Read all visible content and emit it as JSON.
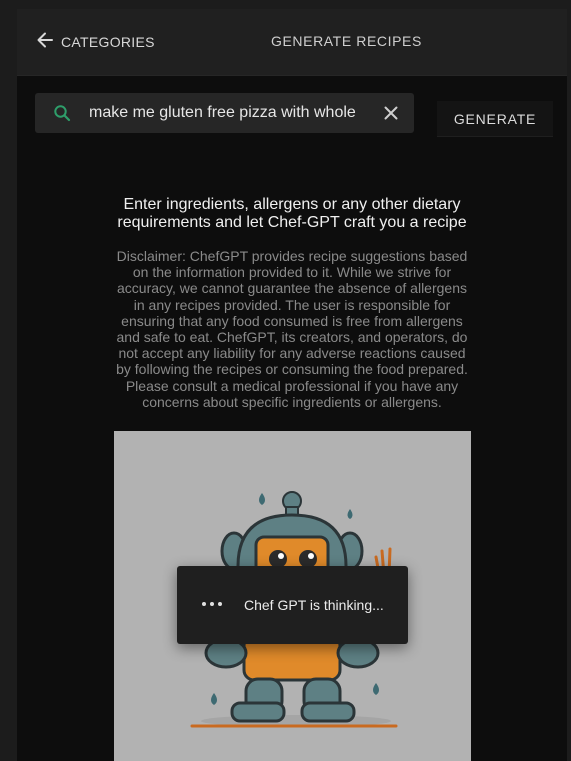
{
  "header": {
    "back_label": "CATEGORIES",
    "title": "GENERATE RECIPES"
  },
  "search": {
    "value": "make me gluten free pizza with whole",
    "placeholder": ""
  },
  "generate_button": "GENERATE",
  "intro": "Enter ingredients, allergens or any other dietary requirements and let Chef-GPT craft you a recipe",
  "disclaimer": "Disclaimer: ChefGPT provides recipe suggestions based on the information provided to it. While we strive for accuracy, we cannot guarantee the absence of allergens in any recipes provided. The user is responsible for ensuring that any food consumed is free from allergens and safe to eat. ChefGPT, its creators, and operators, do not accept any liability for any adverse reactions caused by following the recipes or consuming the food prepared. Please consult a medical professional if you have any concerns about specific ingredients or allergens.",
  "loading": {
    "text": "Chef GPT is thinking..."
  },
  "icons": {
    "back": "arrow-left-icon",
    "search": "search-icon",
    "clear": "close-icon",
    "loading": "more-horizontal-icon"
  },
  "colors": {
    "search_accent": "#2e9e6a",
    "hero_bg": "#b2b2b2",
    "robot_body": "#5e8084",
    "robot_face": "#e08a2a"
  }
}
